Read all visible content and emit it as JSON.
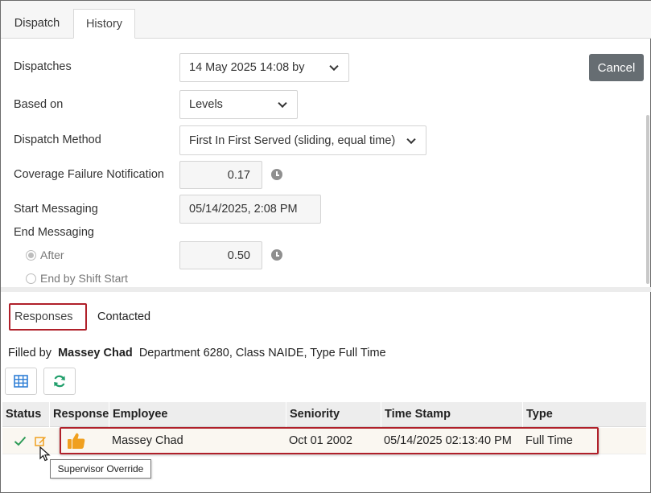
{
  "tabs": [
    {
      "label": "Dispatch",
      "active": false
    },
    {
      "label": "History",
      "active": true
    }
  ],
  "form": {
    "dispatches_label": "Dispatches",
    "dispatches_value": "14 May 2025 14:08 by",
    "based_on_label": "Based on",
    "based_on_value": "Levels",
    "method_label": "Dispatch Method",
    "method_value": "First In First Served (sliding, equal time)",
    "coverage_label": "Coverage Failure Notification",
    "coverage_value": "0.17",
    "start_label": "Start Messaging",
    "start_value": "05/14/2025, 2:08 PM",
    "end_label": "End Messaging",
    "after_label": "After",
    "after_value": "0.50",
    "end_shift_label": "End by Shift Start"
  },
  "cancel_label": "Cancel",
  "sub_tabs": [
    "Responses",
    "Contacted"
  ],
  "filled_by": {
    "prefix": "Filled by",
    "name": "Massey Chad",
    "details": "Department 6280, Class NAIDE, Type Full Time"
  },
  "table": {
    "headers": [
      "Status",
      "Response",
      "Employee",
      "Seniority",
      "Time Stamp",
      "Type"
    ],
    "rows": [
      {
        "employee": "Massey Chad",
        "seniority": "Oct 01 2002",
        "timestamp": "05/14/2025 02:13:40 PM",
        "type": "Full Time"
      }
    ]
  },
  "tooltip": "Supervisor Override",
  "colors": {
    "highlight": "#b0202a",
    "cancel_bg": "#666d72",
    "check": "#2e9b57",
    "thumb": "#f0a020",
    "icon_blue": "#2f7fd6",
    "icon_green": "#1f9e6a"
  }
}
